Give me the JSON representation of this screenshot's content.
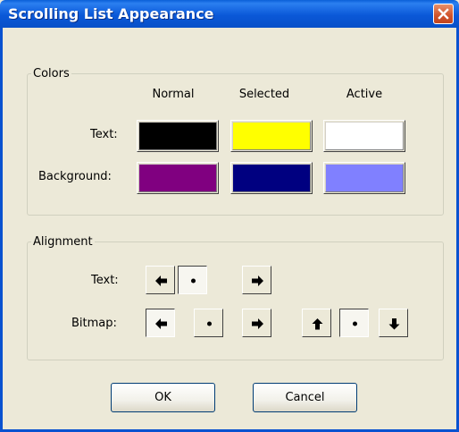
{
  "window": {
    "title": "Scrolling List Appearance"
  },
  "colors_group": {
    "legend": "Colors",
    "columns": [
      "Normal",
      "Selected",
      "Active"
    ],
    "rows": [
      {
        "label": "Text:",
        "swatches": [
          "#000000",
          "#FFFF00",
          "#FFFFFF"
        ]
      },
      {
        "label": "Background:",
        "swatches": [
          "#800080",
          "#000080",
          "#8080FF"
        ]
      }
    ]
  },
  "alignment_group": {
    "legend": "Alignment",
    "text_label": "Text:",
    "bitmap_label": "Bitmap:",
    "text_selected": "center",
    "bitmap_horizontal_selected": "left",
    "bitmap_vertical_selected": "center",
    "icons": [
      "arrow-left-icon",
      "center-dot-icon",
      "arrow-right-icon",
      "arrow-up-icon",
      "arrow-down-icon"
    ]
  },
  "buttons": {
    "ok": "OK",
    "cancel": "Cancel"
  }
}
